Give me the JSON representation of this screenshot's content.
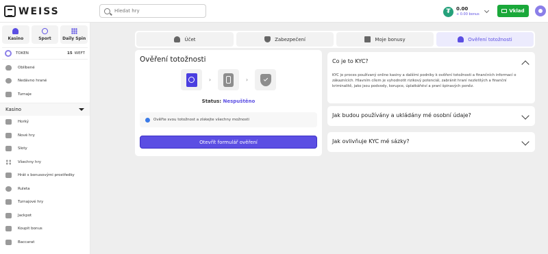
{
  "header": {
    "logo_text": "WEISS",
    "search_placeholder": "Hledat hry",
    "wallet_amount": "0.00",
    "wallet_bonus": "+ 0.00 bonus",
    "deposit_label": "Vklad",
    "colors": {
      "accent": "#5b4ee3",
      "deposit": "#1aa83a",
      "tether": "#26a17b"
    }
  },
  "sidebar": {
    "tabs": [
      {
        "label": "Kasino",
        "icon": "spade-icon"
      },
      {
        "label": "Sport",
        "icon": "ball-icon"
      },
      {
        "label": "Daily Spin",
        "icon": "grid-icon"
      }
    ],
    "token": {
      "label": "TOKEN",
      "amount": "15",
      "unit": "WEFT"
    },
    "quick_items": [
      {
        "label": "Oblíbené",
        "icon": "heart-icon"
      },
      {
        "label": "Nedávno hrané",
        "icon": "clock-icon"
      },
      {
        "label": "Turnaje",
        "icon": "trophy-icon"
      }
    ],
    "casino_section": "Kasino",
    "casino_items": [
      {
        "label": "Horký",
        "icon": "flame-icon"
      },
      {
        "label": "Nové hry",
        "icon": "new-icon"
      },
      {
        "label": "Sloty",
        "icon": "slot-icon"
      },
      {
        "label": "Všechny hry",
        "icon": "grid-icon"
      },
      {
        "label": "Hrát s bonusovými prostředky",
        "icon": "bonus-icon"
      },
      {
        "label": "Ruleta",
        "icon": "roulette-icon"
      },
      {
        "label": "Turnajové hry",
        "icon": "trophy-icon"
      },
      {
        "label": "Jackpot",
        "icon": "jackpot-icon"
      },
      {
        "label": "Koupit bonus",
        "icon": "buy-bonus-icon"
      },
      {
        "label": "Baccarat",
        "icon": "cards-icon"
      }
    ]
  },
  "tabs": [
    {
      "label": "Účet",
      "icon": "user-icon",
      "active": false
    },
    {
      "label": "Zabezpečení",
      "icon": "shield-icon",
      "active": false
    },
    {
      "label": "Moje bonusy",
      "icon": "gift-icon",
      "active": false
    },
    {
      "label": "Ověření totožnosti",
      "icon": "user-check-icon",
      "active": true
    }
  ],
  "kyc": {
    "title": "Ověření totožnosti",
    "steps": [
      "passport-icon",
      "document-icon",
      "shield-check-icon"
    ],
    "status_label": "Status:",
    "status_value": "Nespuštěno",
    "info_text": "Ověřte svou totožnost a získejte všechny možnosti",
    "open_form_label": "Otevřít formulář ověření"
  },
  "faq": [
    {
      "question": "Co je to KYC?",
      "answer": "KYC je proces používaný online kasiny a dalšími podniky k ověření totožnosti a finančních informací o zákaznících. Hlavním cílem je vyhodnotit rizikový potenciál, zabránit hraní nezletilých a finanční kriminalitě, jako jsou podvody, korupce, úplatkářství a praní špinavých peněz.",
      "expanded": true
    },
    {
      "question": "Jak budou používány a ukládány mé osobní údaje?",
      "expanded": false
    },
    {
      "question": "Jak ovlivňuje KYC mé sázky?",
      "expanded": false
    }
  ]
}
